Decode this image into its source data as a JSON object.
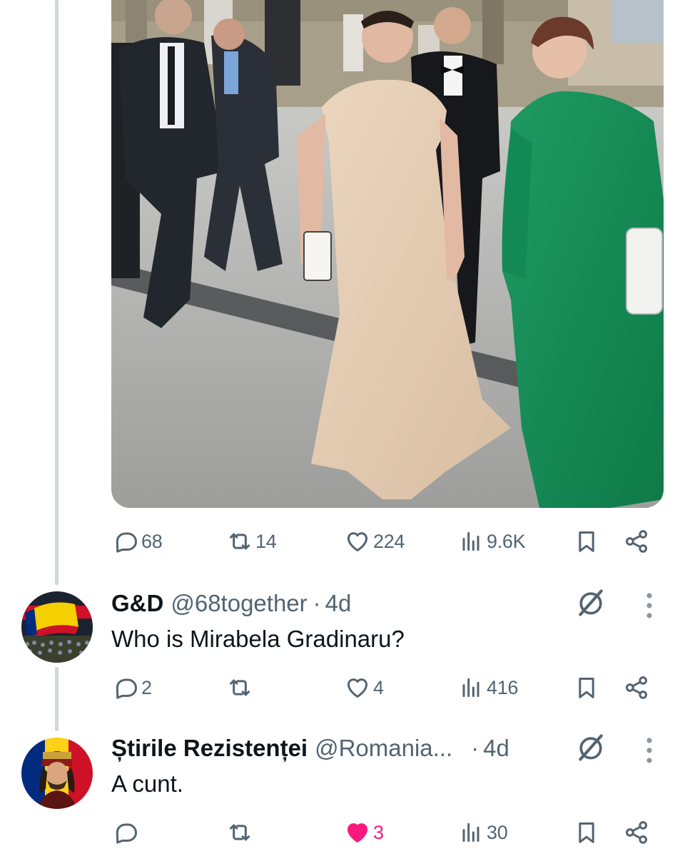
{
  "main_post": {
    "photo_alt": "",
    "actions": {
      "replies": "68",
      "reposts": "14",
      "likes": "224",
      "views": "9.6K"
    }
  },
  "replies": [
    {
      "name": "G&D",
      "handle": "@68together",
      "separator": "·",
      "time": "4d",
      "text": "Who is Mirabela Gradinaru?",
      "avatar_icon": "crowd-flag-avatar",
      "actions": {
        "replies": "2",
        "reposts": "",
        "likes": "4",
        "views": "416"
      },
      "liked": false
    },
    {
      "name": "Știrile Rezistenței",
      "handle": "@Romania...",
      "separator": "·",
      "time": "4d",
      "text": "A cunt.",
      "avatar_icon": "romanian-flag-portrait-avatar",
      "actions": {
        "replies": "",
        "reposts": "",
        "likes": "3",
        "views": "30"
      },
      "liked": true
    }
  ],
  "colors": {
    "text_primary": "#0f1419",
    "text_secondary": "#536471",
    "like_active": "#f91880",
    "thread_line": "#cfd9de"
  }
}
